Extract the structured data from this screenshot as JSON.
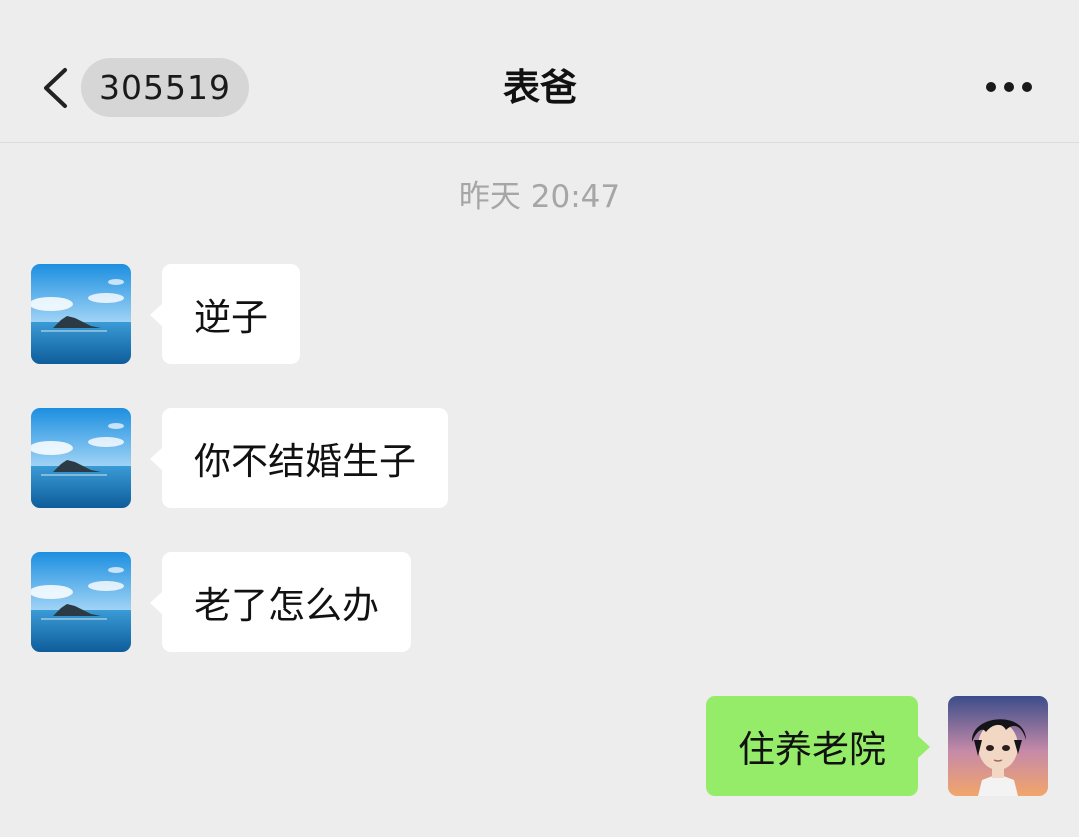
{
  "header": {
    "back_icon": "chevron-left-icon",
    "unread_count": "305519",
    "title": "表爸",
    "more_icon": "more-dots-icon"
  },
  "timestamp": "昨天 20:47",
  "messages": [
    {
      "sender": "contact",
      "avatar": "ocean-island-avatar",
      "text": "逆子"
    },
    {
      "sender": "contact",
      "avatar": "ocean-island-avatar",
      "text": "你不结婚生子"
    },
    {
      "sender": "contact",
      "avatar": "ocean-island-avatar",
      "text": "老了怎么办"
    },
    {
      "sender": "self",
      "avatar": "anime-boy-avatar",
      "text": "住养老院"
    }
  ],
  "colors": {
    "background": "#ededed",
    "incoming_bubble": "#ffffff",
    "outgoing_bubble": "#95ec69",
    "timestamp_text": "#a6a6a6"
  }
}
